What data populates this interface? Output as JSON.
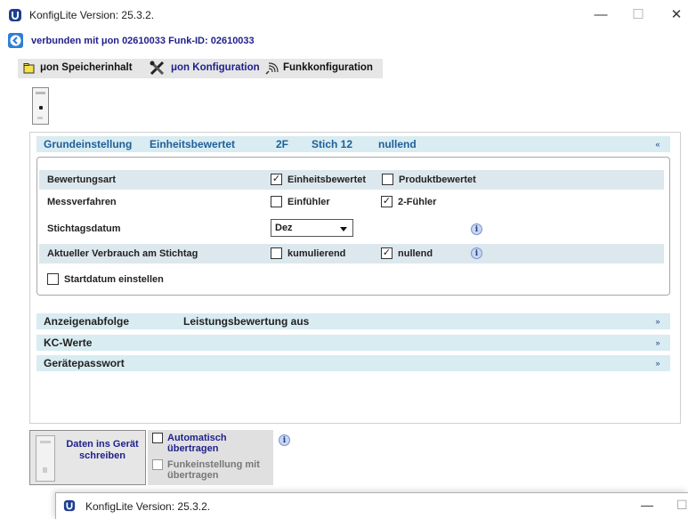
{
  "window": {
    "title": "KonfigLite  Version: 25.3.2.",
    "minimize": "—",
    "maximize": "☐",
    "close": "✕"
  },
  "connection": {
    "text": "verbunden mit μon 02610033 Funk-ID: 02610033"
  },
  "tabs": [
    {
      "label": "μon Speicherinhalt",
      "icon": "folder-icon"
    },
    {
      "label": "μon Konfiguration",
      "icon": "tools-icon",
      "active": true
    },
    {
      "label": "Funkkonfiguration",
      "icon": "radio-icon"
    }
  ],
  "sections": {
    "grund": {
      "title": "Grundeinstellung",
      "value1": "Einheitsbewertet",
      "value2": "2F",
      "value3": "Stich 12",
      "value4": "nullend",
      "chevron": "«"
    },
    "anzeigen": {
      "title": "Anzeigenabfolge",
      "value": "Leistungsbewertung aus",
      "chevron": "»"
    },
    "kc": {
      "title": "KC-Werte",
      "chevron": "»"
    },
    "passwort": {
      "title": "Gerätepasswort",
      "chevron": "»"
    }
  },
  "settings": {
    "bewertungsart": {
      "label": "Bewertungsart",
      "opt1": "Einheitsbewertet",
      "opt1_checked": true,
      "opt2": "Produktbewertet",
      "opt2_checked": false
    },
    "messverfahren": {
      "label": "Messverfahren",
      "opt1": "Einfühler",
      "opt1_checked": false,
      "opt2": "2-Fühler",
      "opt2_checked": true
    },
    "stichtag": {
      "label": "Stichtagsdatum",
      "value": "Dez"
    },
    "verbrauch": {
      "label": "Aktueller Verbrauch am Stichtag",
      "opt1": "kumulierend",
      "opt1_checked": false,
      "opt2": "nullend",
      "opt2_checked": true
    },
    "startdatum": {
      "label": "Startdatum einstellen",
      "checked": false
    }
  },
  "bottom": {
    "write_button": "Daten ins Gerät schreiben",
    "auto_transfer": "Automatisch übertragen",
    "radio_setting": "Funkeinstellung mit übertragen"
  },
  "second_window": {
    "title": "KonfigLite  Version: 25.3.2.",
    "minimize": "—",
    "maximize": "☐"
  },
  "colors": {
    "accent": "#1f5f98",
    "section_bg": "#d8ecf2",
    "link": "#1f1f8c"
  }
}
